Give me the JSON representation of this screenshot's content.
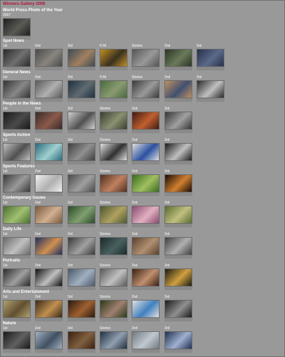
{
  "gallery_title": "Winners Gallery 2008",
  "categories": [
    {
      "title": "World Press Photo of the Year",
      "items": [
        {
          "label": "2007",
          "c1": "#1f1f1f",
          "c2": "#5a5a55"
        }
      ]
    },
    {
      "title": "Spot News",
      "items": [
        {
          "label": "1st",
          "c1": "#2a2a2a",
          "c2": "#707070"
        },
        {
          "label": "2nd",
          "c1": "#4a4a48",
          "c2": "#8a8580"
        },
        {
          "label": "3rd",
          "c1": "#3d4a55",
          "c2": "#a08060"
        },
        {
          "label": "H.M.",
          "c1": "#c09020",
          "c2": "#3a3020"
        },
        {
          "label": "Stories",
          "c1": "#555555",
          "c2": "#999999"
        },
        {
          "label": "2nd",
          "c1": "#2a3525",
          "c2": "#6a7a5a"
        },
        {
          "label": "3rd",
          "c1": "#28304a",
          "c2": "#5a6a8a"
        }
      ]
    },
    {
      "title": "General News",
      "items": [
        {
          "label": "1st",
          "c1": "#333333",
          "c2": "#888888"
        },
        {
          "label": "2nd",
          "c1": "#5a5a5a",
          "c2": "#b0b0b0"
        },
        {
          "label": "3rd",
          "c1": "#203040",
          "c2": "#606a70"
        },
        {
          "label": "H.M.",
          "c1": "#4a6a40",
          "c2": "#8a9a70"
        },
        {
          "label": "Stories",
          "c1": "#3a3a3a",
          "c2": "#9a9a9a"
        },
        {
          "label": "2nd",
          "c1": "#c09060",
          "c2": "#405070"
        },
        {
          "label": "3rd",
          "c1": "#2a2a2a",
          "c2": "#c0c0c0"
        }
      ]
    },
    {
      "title": "People in the News",
      "items": [
        {
          "label": "1st",
          "c1": "#1a1a1a",
          "c2": "#4a4a4a"
        },
        {
          "label": "2nd",
          "c1": "#3a2a2a",
          "c2": "#8a5a4a"
        },
        {
          "label": "3rd",
          "c1": "#d0d0d0",
          "c2": "#505050"
        },
        {
          "label": "Stories",
          "c1": "#3a4030",
          "c2": "#8a9070"
        },
        {
          "label": "2nd",
          "c1": "#401a10",
          "c2": "#c06030"
        },
        {
          "label": "3rd",
          "c1": "#353535",
          "c2": "#a0a0a0"
        }
      ]
    },
    {
      "title": "Sports Action",
      "items": [
        {
          "label": "1st",
          "c1": "#c0c0c0",
          "c2": "#505050"
        },
        {
          "label": "2nd",
          "c1": "#2a6a7a",
          "c2": "#a0d0d0"
        },
        {
          "label": "3rd",
          "c1": "#404040",
          "c2": "#909090"
        },
        {
          "label": "Stories",
          "c1": "#e0e0e0",
          "c2": "#303030"
        },
        {
          "label": "2nd",
          "c1": "#e0e0e0",
          "c2": "#2a50a0"
        },
        {
          "label": "3rd",
          "c1": "#1a1a1a",
          "c2": "#c0c0c0"
        }
      ]
    },
    {
      "title": "Sports Features",
      "items": [
        {
          "label": "1st",
          "c1": "#3a3a3a",
          "c2": "#9a9a9a"
        },
        {
          "label": "2nd",
          "c1": "#f0f0f0",
          "c2": "#b0b0b0"
        },
        {
          "label": "3rd",
          "c1": "#4a4a4a",
          "c2": "#a0a0a0"
        },
        {
          "label": "Stories",
          "c1": "#503020",
          "c2": "#c08060"
        },
        {
          "label": "2nd",
          "c1": "#3a6a20",
          "c2": "#a0c060"
        },
        {
          "label": "3rd",
          "c1": "#1a0a05",
          "c2": "#d08030"
        }
      ]
    },
    {
      "title": "Contemporary Issues",
      "items": [
        {
          "label": "1st",
          "c1": "#4a7030",
          "c2": "#a0c070"
        },
        {
          "label": "2nd",
          "c1": "#7a5a40",
          "c2": "#d0b090"
        },
        {
          "label": "3rd",
          "c1": "#2a4a2a",
          "c2": "#80a070"
        },
        {
          "label": "Stories",
          "c1": "#4a5a30",
          "c2": "#b0a060"
        },
        {
          "label": "2nd",
          "c1": "#8a4a70",
          "c2": "#e0b0c0"
        },
        {
          "label": "3rd",
          "c1": "#5a6a30",
          "c2": "#c0c080"
        }
      ]
    },
    {
      "title": "Daily Life",
      "items": [
        {
          "label": "1st",
          "c1": "#6a6a6a",
          "c2": "#c0c0c0"
        },
        {
          "label": "2nd",
          "c1": "#203060",
          "c2": "#d09050"
        },
        {
          "label": "3rd",
          "c1": "#3a3a3a",
          "c2": "#a0a0a0"
        },
        {
          "label": "Stories",
          "c1": "#1a2a2a",
          "c2": "#4a6060"
        },
        {
          "label": "2nd",
          "c1": "#5a4030",
          "c2": "#b09070"
        },
        {
          "label": "3rd",
          "c1": "#404040",
          "c2": "#b0b0b0"
        }
      ]
    },
    {
      "title": "Portraits",
      "items": [
        {
          "label": "1st",
          "c1": "#2a2a2a",
          "c2": "#a0a0a0"
        },
        {
          "label": "2nd",
          "c1": "#101010",
          "c2": "#c0c0c0"
        },
        {
          "label": "3rd",
          "c1": "#4a5a6a",
          "c2": "#a0b0c0"
        },
        {
          "label": "Stories",
          "c1": "#5a5a5a",
          "c2": "#c0c0c0"
        },
        {
          "label": "2nd",
          "c1": "#3a2010",
          "c2": "#c09070"
        },
        {
          "label": "3rd",
          "c1": "#1a1a10",
          "c2": "#d0a040"
        }
      ]
    },
    {
      "title": "Arts and Entertainment",
      "items": [
        {
          "label": "1st",
          "c1": "#b0a070",
          "c2": "#605030"
        },
        {
          "label": "2nd",
          "c1": "#3a2a1a",
          "c2": "#c09050"
        },
        {
          "label": "3rd",
          "c1": "#2a1a10",
          "c2": "#a06030"
        },
        {
          "label": "Stories",
          "c1": "#2a3a1a",
          "c2": "#a08070"
        },
        {
          "label": "2nd",
          "c1": "#e0e0e0",
          "c2": "#4080c0"
        },
        {
          "label": "3rd",
          "c1": "#1a1a1a",
          "c2": "#909090"
        }
      ]
    },
    {
      "title": "Nature",
      "items": [
        {
          "label": "1st",
          "c1": "#1a1a1a",
          "c2": "#606060"
        },
        {
          "label": "2nd",
          "c1": "#a0b0c0",
          "c2": "#405060"
        },
        {
          "label": "3rd",
          "c1": "#3a2010",
          "c2": "#806040"
        },
        {
          "label": "Stories",
          "c1": "#203040",
          "c2": "#90a0b0"
        },
        {
          "label": "2nd",
          "c1": "#707a80",
          "c2": "#c0c8d0"
        },
        {
          "label": "3rd",
          "c1": "#203050",
          "c2": "#a0b0d0"
        }
      ]
    }
  ]
}
